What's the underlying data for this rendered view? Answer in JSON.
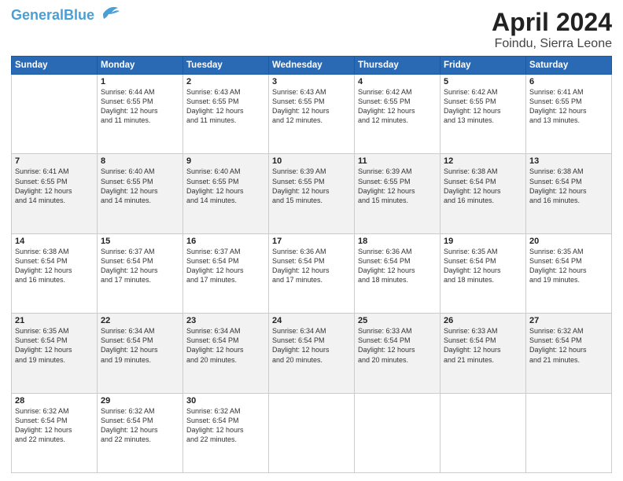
{
  "header": {
    "logo_line1": "General",
    "logo_line2": "Blue",
    "title": "April 2024",
    "subtitle": "Foindu, Sierra Leone"
  },
  "days_of_week": [
    "Sunday",
    "Monday",
    "Tuesday",
    "Wednesday",
    "Thursday",
    "Friday",
    "Saturday"
  ],
  "weeks": [
    [
      {
        "day": "",
        "info": ""
      },
      {
        "day": "1",
        "info": "Sunrise: 6:44 AM\nSunset: 6:55 PM\nDaylight: 12 hours\nand 11 minutes."
      },
      {
        "day": "2",
        "info": "Sunrise: 6:43 AM\nSunset: 6:55 PM\nDaylight: 12 hours\nand 11 minutes."
      },
      {
        "day": "3",
        "info": "Sunrise: 6:43 AM\nSunset: 6:55 PM\nDaylight: 12 hours\nand 12 minutes."
      },
      {
        "day": "4",
        "info": "Sunrise: 6:42 AM\nSunset: 6:55 PM\nDaylight: 12 hours\nand 12 minutes."
      },
      {
        "day": "5",
        "info": "Sunrise: 6:42 AM\nSunset: 6:55 PM\nDaylight: 12 hours\nand 13 minutes."
      },
      {
        "day": "6",
        "info": "Sunrise: 6:41 AM\nSunset: 6:55 PM\nDaylight: 12 hours\nand 13 minutes."
      }
    ],
    [
      {
        "day": "7",
        "info": "Sunrise: 6:41 AM\nSunset: 6:55 PM\nDaylight: 12 hours\nand 14 minutes."
      },
      {
        "day": "8",
        "info": "Sunrise: 6:40 AM\nSunset: 6:55 PM\nDaylight: 12 hours\nand 14 minutes."
      },
      {
        "day": "9",
        "info": "Sunrise: 6:40 AM\nSunset: 6:55 PM\nDaylight: 12 hours\nand 14 minutes."
      },
      {
        "day": "10",
        "info": "Sunrise: 6:39 AM\nSunset: 6:55 PM\nDaylight: 12 hours\nand 15 minutes."
      },
      {
        "day": "11",
        "info": "Sunrise: 6:39 AM\nSunset: 6:55 PM\nDaylight: 12 hours\nand 15 minutes."
      },
      {
        "day": "12",
        "info": "Sunrise: 6:38 AM\nSunset: 6:54 PM\nDaylight: 12 hours\nand 16 minutes."
      },
      {
        "day": "13",
        "info": "Sunrise: 6:38 AM\nSunset: 6:54 PM\nDaylight: 12 hours\nand 16 minutes."
      }
    ],
    [
      {
        "day": "14",
        "info": "Sunrise: 6:38 AM\nSunset: 6:54 PM\nDaylight: 12 hours\nand 16 minutes."
      },
      {
        "day": "15",
        "info": "Sunrise: 6:37 AM\nSunset: 6:54 PM\nDaylight: 12 hours\nand 17 minutes."
      },
      {
        "day": "16",
        "info": "Sunrise: 6:37 AM\nSunset: 6:54 PM\nDaylight: 12 hours\nand 17 minutes."
      },
      {
        "day": "17",
        "info": "Sunrise: 6:36 AM\nSunset: 6:54 PM\nDaylight: 12 hours\nand 17 minutes."
      },
      {
        "day": "18",
        "info": "Sunrise: 6:36 AM\nSunset: 6:54 PM\nDaylight: 12 hours\nand 18 minutes."
      },
      {
        "day": "19",
        "info": "Sunrise: 6:35 AM\nSunset: 6:54 PM\nDaylight: 12 hours\nand 18 minutes."
      },
      {
        "day": "20",
        "info": "Sunrise: 6:35 AM\nSunset: 6:54 PM\nDaylight: 12 hours\nand 19 minutes."
      }
    ],
    [
      {
        "day": "21",
        "info": "Sunrise: 6:35 AM\nSunset: 6:54 PM\nDaylight: 12 hours\nand 19 minutes."
      },
      {
        "day": "22",
        "info": "Sunrise: 6:34 AM\nSunset: 6:54 PM\nDaylight: 12 hours\nand 19 minutes."
      },
      {
        "day": "23",
        "info": "Sunrise: 6:34 AM\nSunset: 6:54 PM\nDaylight: 12 hours\nand 20 minutes."
      },
      {
        "day": "24",
        "info": "Sunrise: 6:34 AM\nSunset: 6:54 PM\nDaylight: 12 hours\nand 20 minutes."
      },
      {
        "day": "25",
        "info": "Sunrise: 6:33 AM\nSunset: 6:54 PM\nDaylight: 12 hours\nand 20 minutes."
      },
      {
        "day": "26",
        "info": "Sunrise: 6:33 AM\nSunset: 6:54 PM\nDaylight: 12 hours\nand 21 minutes."
      },
      {
        "day": "27",
        "info": "Sunrise: 6:32 AM\nSunset: 6:54 PM\nDaylight: 12 hours\nand 21 minutes."
      }
    ],
    [
      {
        "day": "28",
        "info": "Sunrise: 6:32 AM\nSunset: 6:54 PM\nDaylight: 12 hours\nand 22 minutes."
      },
      {
        "day": "29",
        "info": "Sunrise: 6:32 AM\nSunset: 6:54 PM\nDaylight: 12 hours\nand 22 minutes."
      },
      {
        "day": "30",
        "info": "Sunrise: 6:32 AM\nSunset: 6:54 PM\nDaylight: 12 hours\nand 22 minutes."
      },
      {
        "day": "",
        "info": ""
      },
      {
        "day": "",
        "info": ""
      },
      {
        "day": "",
        "info": ""
      },
      {
        "day": "",
        "info": ""
      }
    ]
  ]
}
